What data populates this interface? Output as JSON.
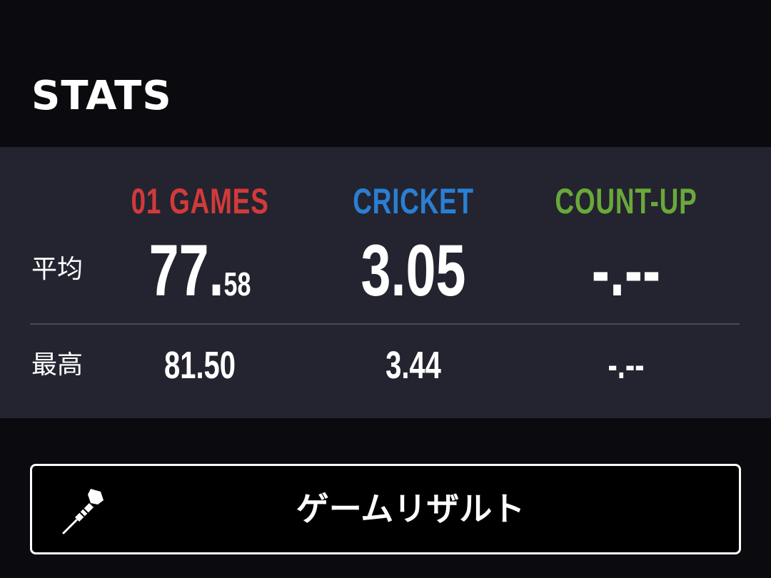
{
  "stats": {
    "title": "STATS",
    "columns": [
      {
        "label": "01 GAMES",
        "color": "#d23a3a"
      },
      {
        "label": "CRICKET",
        "color": "#2a7fd4"
      },
      {
        "label": "COUNT-UP",
        "color": "#6aa83a"
      }
    ],
    "rows": {
      "average": {
        "label": "平均",
        "values": [
          {
            "main": "77.",
            "fraction": "58"
          },
          {
            "main": "3.05",
            "fraction": ""
          },
          {
            "main": "-.--",
            "fraction": ""
          }
        ]
      },
      "best": {
        "label": "最高",
        "values": [
          "81.50",
          "3.44",
          "-.--"
        ]
      }
    }
  },
  "result_button": {
    "label": "ゲームリザルト",
    "icon": "dart-icon"
  }
}
